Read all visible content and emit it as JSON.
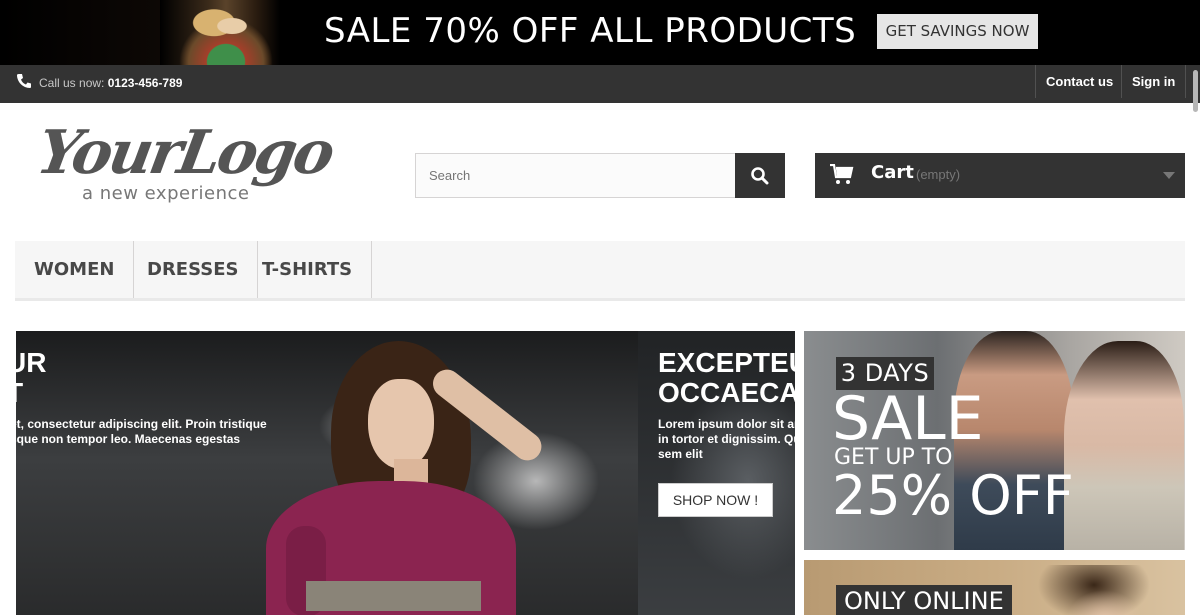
{
  "promo": {
    "text": "SALE 70% OFF ALL PRODUCTS",
    "button": "GET SAVINGS NOW"
  },
  "topnav": {
    "call_label": "Call us now:",
    "phone": "0123-456-789",
    "contact": "Contact us",
    "signin": "Sign in"
  },
  "logo": {
    "title": "YourLogo",
    "tagline": "a new experience"
  },
  "search": {
    "placeholder": "Search"
  },
  "cart": {
    "label": "Cart",
    "status": "(empty)"
  },
  "menu": {
    "items": [
      "WOMEN",
      "DRESSES",
      "T-SHIRTS"
    ]
  },
  "slider": {
    "slide1_title_line1": "UR",
    "slide1_title_line2": "T",
    "slide1_desc_line1": "et, consectetur adipiscing elit. Proin tristique",
    "slide1_desc_line2": "sque non tempor leo. Maecenas egestas",
    "slide2_title_line1": "EXCEPTEU",
    "slide2_title_line2": "OCCAECA",
    "slide2_desc_line1": "Lorem ipsum dolor sit ame",
    "slide2_desc_line2": "in tortor et dignissim. Quis",
    "slide2_desc_line3": "sem elit",
    "shop_button": "SHOP NOW !"
  },
  "banners": {
    "b1_tag": "3 DAYS",
    "b1_sale": "SALE",
    "b1_get": "GET UP TO",
    "b1_off": "25% OFF",
    "b2_tag": "ONLY ONLINE"
  },
  "colors": {
    "dark": "#333333",
    "menu_bg": "#f6f6f6",
    "promo_bg": "#000000"
  }
}
